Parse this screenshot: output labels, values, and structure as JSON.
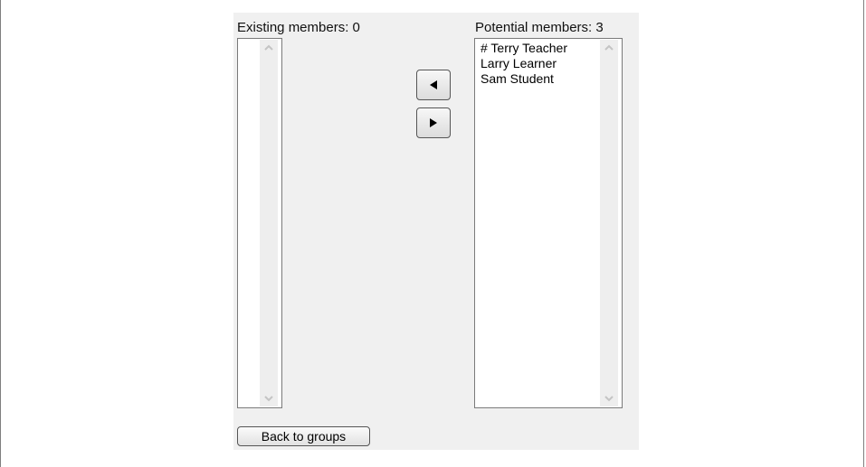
{
  "existing": {
    "caption": "Existing members: 0",
    "items": []
  },
  "potential": {
    "caption": "Potential members: 3",
    "items": [
      "# Terry Teacher",
      "Larry Learner",
      "Sam Student"
    ]
  },
  "buttons": {
    "add_icon": "left-arrow-icon",
    "remove_icon": "right-arrow-icon",
    "back_label": "Back to groups"
  }
}
